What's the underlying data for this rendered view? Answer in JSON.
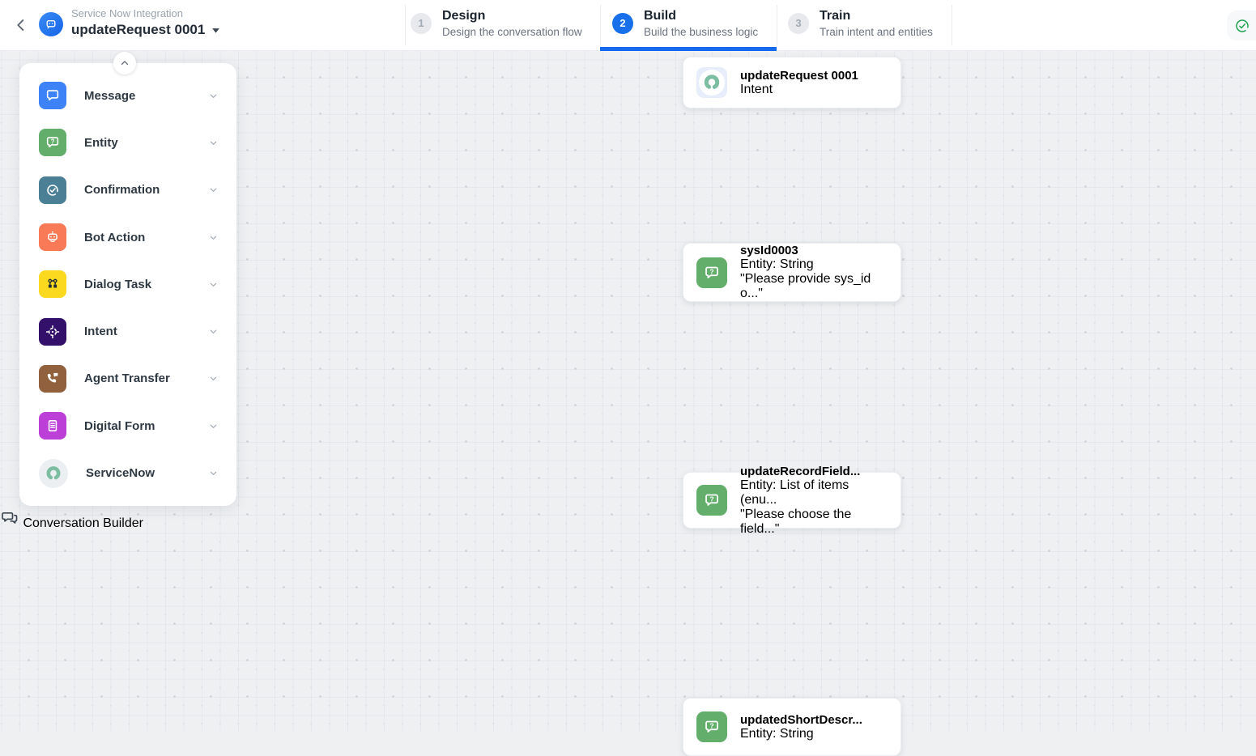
{
  "palette": {
    "accent_blue": "#176FEA",
    "underline_blue": "#1569EE",
    "canvas_bg": "#EEF0F2",
    "connector_gray": "#5F6368",
    "success_green": "#21A24C",
    "message": "#3D82F7",
    "entity": "#63AE6B",
    "confirmation": "#4A7F96",
    "bot_action": "#F87A56",
    "dialog_task": "#FAD91F",
    "intent": "#331069",
    "agent_transfer": "#91613D",
    "digital_form": "#BC3FD8",
    "servicenow_green": "#7DBDA2"
  },
  "header": {
    "app_label": "Service Now Integration",
    "dialog_title": "updateRequest 0001",
    "steps": [
      {
        "number": "1",
        "label": "Design",
        "sublabel": "Design the conversation flow",
        "active": false
      },
      {
        "number": "2",
        "label": "Build",
        "sublabel": "Build the business logic",
        "active": true
      },
      {
        "number": "3",
        "label": "Train",
        "sublabel": "Train intent and entities",
        "active": false
      }
    ]
  },
  "sidebar": {
    "items": [
      {
        "label": "Message",
        "color": "#3D82F7",
        "icon": "message-icon"
      },
      {
        "label": "Entity",
        "color": "#63AE6B",
        "icon": "entity-icon"
      },
      {
        "label": "Confirmation",
        "color": "#4A7F96",
        "icon": "confirmation-icon"
      },
      {
        "label": "Bot Action",
        "color": "#F87A56",
        "icon": "bot-action-icon"
      },
      {
        "label": "Dialog Task",
        "color": "#FAD91F",
        "icon": "dialog-task-icon"
      },
      {
        "label": "Intent",
        "color": "#331069",
        "icon": "intent-icon"
      },
      {
        "label": "Agent Transfer",
        "color": "#91613D",
        "icon": "agent-transfer-icon"
      },
      {
        "label": "Digital Form",
        "color": "#BC3FD8",
        "icon": "digital-form-icon"
      },
      {
        "label": "ServiceNow",
        "color": "#7DBDA2",
        "icon": "servicenow-icon"
      }
    ]
  },
  "canvas": {
    "nodes": [
      {
        "title": "updateRequest 0001",
        "subtitle": "Intent",
        "quote": "",
        "icon": "servicenow-icon"
      },
      {
        "title": "sysId0003",
        "subtitle": "Entity: String",
        "quote": "\"Please provide sys_id o...\"",
        "icon": "entity-icon"
      },
      {
        "title": "updateRecordField...",
        "subtitle": "Entity: List of items (enu...",
        "quote": "\"Please choose the field...\"",
        "icon": "entity-icon"
      },
      {
        "title": "updatedShortDescr...",
        "subtitle": "Entity: String",
        "quote": "",
        "icon": "entity-icon"
      }
    ]
  },
  "footer": {
    "builder_label": "Conversation Builder"
  }
}
